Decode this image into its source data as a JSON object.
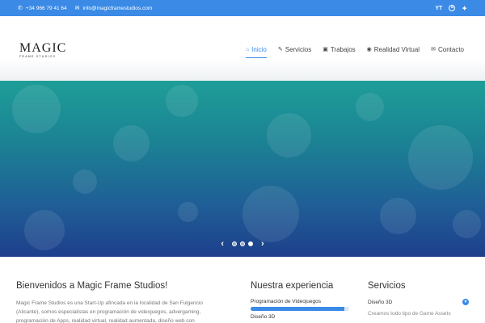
{
  "topbar": {
    "phone": "+34 966 79 41 64",
    "email": "info@magicframestudios.com",
    "social": {
      "youtube": "YT",
      "skype": "S",
      "twitter": "🐦"
    }
  },
  "logo": {
    "main": "MAGIC",
    "sub": "FRAME STUDIOS"
  },
  "nav": [
    {
      "label": "Inicio",
      "icon": "home-icon",
      "glyph": "⌂"
    },
    {
      "label": "Servicios",
      "icon": "wrench-icon",
      "glyph": "✎"
    },
    {
      "label": "Trabajos",
      "icon": "briefcase-icon",
      "glyph": "▣"
    },
    {
      "label": "Realidad Virtual",
      "icon": "eye-icon",
      "glyph": "◉"
    },
    {
      "label": "Contacto",
      "icon": "envelope-icon",
      "glyph": "✉"
    }
  ],
  "slider": {
    "prev": "‹",
    "next": "›",
    "active_slide": 2,
    "slide_count": 3
  },
  "welcome": {
    "title": "Bienvenidos a Magic Frame Studios!",
    "text": "Magic Frame Studios es una Start-Up afincada en la localidad de San Fulgencio (Alicante), somos especialistas en programación de videojuegos, advergaming, programación de Apps, realidad virtual, realidad aumentada, diseño web con"
  },
  "experience": {
    "title": "Nuestra experiencia",
    "skills": [
      {
        "label": "Programación de Videojuegos",
        "percent": 95
      },
      {
        "label": "Diseño 3D"
      }
    ]
  },
  "services": {
    "title": "Servicios",
    "item_title": "Diseño 3D",
    "item_body": "Creamos todo tipo de Game Assets"
  },
  "colors": {
    "accent": "#3a8ae6",
    "hero_top": "#1e9e98",
    "hero_bottom": "#1e3f8c"
  }
}
